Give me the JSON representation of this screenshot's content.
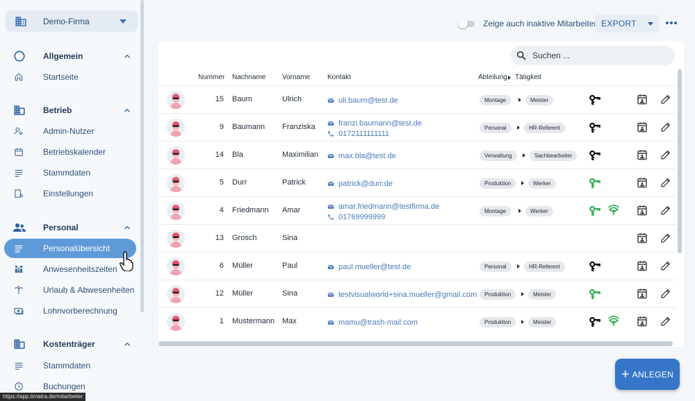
{
  "company": {
    "name": "Demo-Firma"
  },
  "sidebar": {
    "groups": [
      {
        "label": "Allgemein",
        "items": [
          {
            "label": "Startseite",
            "icon": "home-icon"
          }
        ]
      },
      {
        "label": "Betrieb",
        "items": [
          {
            "label": "Admin-Nutzer",
            "icon": "admin-user-icon"
          },
          {
            "label": "Betriebskalender",
            "icon": "calendar-icon"
          },
          {
            "label": "Stammdaten",
            "icon": "list-icon"
          },
          {
            "label": "Einstellungen",
            "icon": "settings-icon"
          }
        ]
      },
      {
        "label": "Personal",
        "items": [
          {
            "label": "Personalübersicht",
            "icon": "list-icon",
            "active": true
          },
          {
            "label": "Anwesenheitszeiten",
            "icon": "people-icon"
          },
          {
            "label": "Urlaub & Abwesenheiten",
            "icon": "palm-icon"
          },
          {
            "label": "Lohnvorberechnung",
            "icon": "money-icon"
          }
        ]
      },
      {
        "label": "Kostenträger",
        "items": [
          {
            "label": "Stammdaten",
            "icon": "list-icon"
          },
          {
            "label": "Buchungen",
            "icon": "clock-icon"
          }
        ]
      }
    ]
  },
  "status_url": "https://app.timatra.de/mitarbeiter",
  "topbar": {
    "toggle_label": "Zeige auch inaktive Mitarbeiter",
    "export_label": "EXPORT"
  },
  "search": {
    "placeholder": "Suchen ..."
  },
  "table": {
    "headers": {
      "nummer": "Nummer",
      "nachname": "Nachname",
      "vorname": "Vorname",
      "kontakt": "Kontakt",
      "abteilung": "Abteilung",
      "taetigkeit": "Tätigkeit"
    },
    "rows": [
      {
        "nummer": "15",
        "nachname": "Baum",
        "vorname": "Ulrich",
        "email": "uli.baum@test.de",
        "phone": "",
        "abteilung": "Montage",
        "taetigkeit": "Meister",
        "key": "black",
        "wifi": false
      },
      {
        "nummer": "9",
        "nachname": "Baumann",
        "vorname": "Franziska",
        "email": "franzi.baumann@test.de",
        "phone": "0172111111111",
        "abteilung": "Personal",
        "taetigkeit": "HR-Referent",
        "key": "black",
        "wifi": false
      },
      {
        "nummer": "14",
        "nachname": "Bla",
        "vorname": "Maximilian",
        "email": "max.bla@test.de",
        "phone": "",
        "abteilung": "Verwaltung",
        "taetigkeit": "Sachbearbeiter",
        "key": "black",
        "wifi": false
      },
      {
        "nummer": "5",
        "nachname": "Durr",
        "vorname": "Patrick",
        "email": "patrick@durr.de",
        "phone": "",
        "abteilung": "Produktion",
        "taetigkeit": "Werker",
        "key": "green",
        "wifi": false
      },
      {
        "nummer": "4",
        "nachname": "Friedmann",
        "vorname": "Amar",
        "email": "amar.friedmann@testfirma.de",
        "phone": "01769999999",
        "abteilung": "Montage",
        "taetigkeit": "Werker",
        "key": "green",
        "wifi": true
      },
      {
        "nummer": "13",
        "nachname": "Grosch",
        "vorname": "Sina",
        "email": "",
        "phone": "",
        "abteilung": "",
        "taetigkeit": "",
        "key": "",
        "wifi": false
      },
      {
        "nummer": "6",
        "nachname": "Müller",
        "vorname": "Paul",
        "email": "paul.mueller@test.de",
        "phone": "",
        "abteilung": "Personal",
        "taetigkeit": "HR-Referent",
        "key": "black",
        "wifi": false
      },
      {
        "nummer": "12",
        "nachname": "Müller",
        "vorname": "Sina",
        "email": "testvisualworld+sina.mueller@gmail.com",
        "phone": "",
        "abteilung": "Produktion",
        "taetigkeit": "Meister",
        "key": "green",
        "wifi": false
      },
      {
        "nummer": "1",
        "nachname": "Mustermann",
        "vorname": "Max",
        "email": "mamu@trash-mail.com",
        "phone": "",
        "abteilung": "Produktion",
        "taetigkeit": "Meister",
        "key": "black",
        "wifi": true
      }
    ]
  },
  "fab": {
    "label": "ANLEGEN"
  },
  "colors": {
    "accent": "#3576c9",
    "active_pill": "#5f9ad8",
    "green_icon": "#2fae52"
  }
}
